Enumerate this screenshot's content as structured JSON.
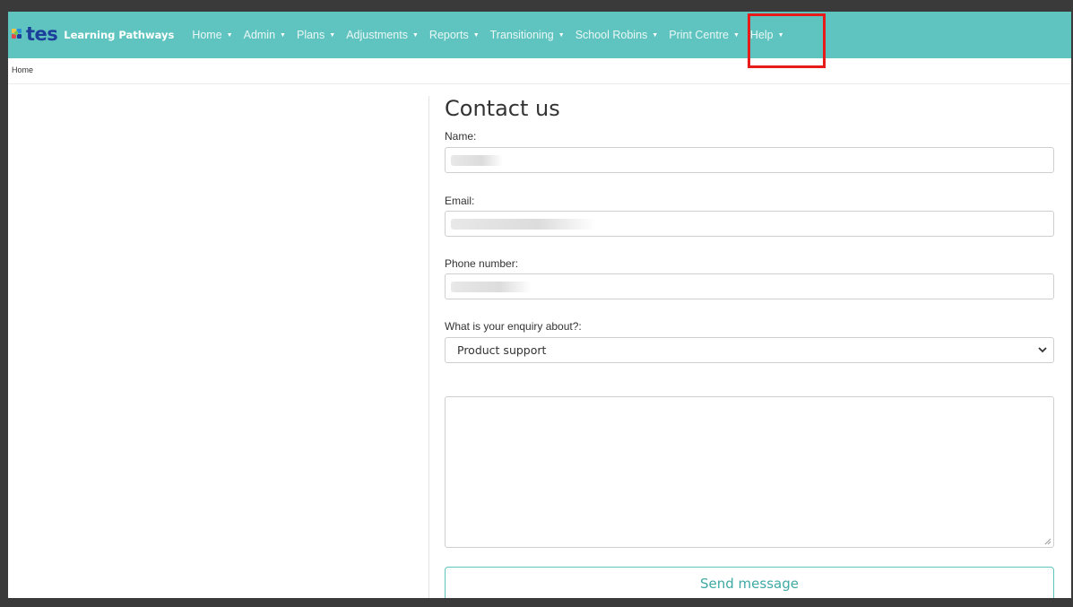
{
  "brand": {
    "logo_text": "tes",
    "app_name": "Learning Pathways"
  },
  "nav": [
    {
      "label": "Home"
    },
    {
      "label": "Admin"
    },
    {
      "label": "Plans"
    },
    {
      "label": "Adjustments"
    },
    {
      "label": "Reports"
    },
    {
      "label": "Transitioning"
    },
    {
      "label": "School Robins"
    },
    {
      "label": "Print Centre"
    },
    {
      "label": "Help"
    }
  ],
  "breadcrumb": "Home",
  "form": {
    "title": "Contact us",
    "name_label": "Name:",
    "email_label": "Email:",
    "phone_label": "Phone number:",
    "enquiry_label": "What is your enquiry about?:",
    "enquiry_selected": "Product support",
    "message_value": "",
    "send_label": "Send message"
  },
  "colors": {
    "navbar": "#5fc4bf",
    "logo": "#1d3f9c",
    "highlight": "#e81b1b",
    "button_text": "#3fa9a4"
  }
}
